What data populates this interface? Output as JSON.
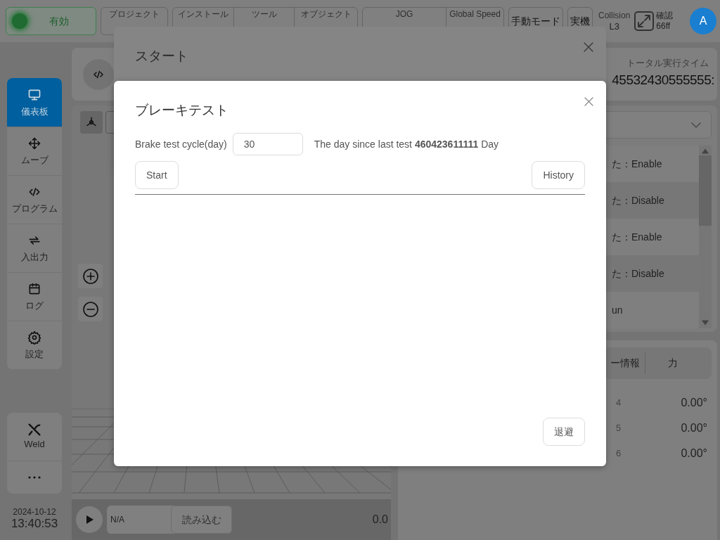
{
  "top_bar": {
    "status_button": {
      "label": "有効",
      "on": true
    },
    "groups": [
      {
        "items": [
          {
            "label": "プロジェクト"
          }
        ]
      },
      {
        "items": [
          {
            "label": "インストール"
          },
          {
            "label": "ツール"
          },
          {
            "label": "オブジェクト"
          }
        ]
      },
      {
        "items": [
          {
            "label": "JOG"
          },
          {
            "label": "Global Speed"
          }
        ]
      }
    ],
    "mode_buttons": [
      "手動モード",
      "実機"
    ],
    "collision": {
      "label": "Collision",
      "value": "L3"
    },
    "confirm": {
      "label": "確認",
      "value": "66ff"
    },
    "avatar": "A"
  },
  "sidebar": {
    "items": [
      {
        "label": "儀表板",
        "selected": true
      },
      {
        "label": "ムーブ",
        "selected": false
      },
      {
        "label": "プログラム",
        "selected": false
      },
      {
        "label": "入出力",
        "selected": false
      },
      {
        "label": "ログ",
        "selected": false
      },
      {
        "label": "設定",
        "selected": false
      }
    ],
    "plugin": {
      "label": "Weld"
    },
    "date": "2024-10-12",
    "time": "13:40:53"
  },
  "viewer": {
    "file_field": "N/A",
    "load_button": "読み込む",
    "reading": "0.0"
  },
  "right_panel": {
    "runtime": {
      "label": "トータル実行タイム",
      "value": "45532430555555:"
    },
    "log_rows": [
      {
        "text": "た：Enable"
      },
      {
        "text": "た：Disable"
      },
      {
        "text": "た：Enable"
      },
      {
        "text": "た：Disable"
      },
      {
        "text": "un"
      }
    ],
    "tabs": [
      {
        "label": "ー情報",
        "selected": false
      },
      {
        "label": "力",
        "selected": false
      }
    ],
    "joints": [
      {
        "label": "4",
        "value": "0.00°"
      },
      {
        "label": "5",
        "value": "0.00°"
      },
      {
        "label": "6",
        "value": "0.00°"
      }
    ]
  },
  "start_dialog": {
    "title": "スタート"
  },
  "brake_dialog": {
    "title": "ブレーキテスト",
    "cycle_label": "Brake test cycle(day)",
    "cycle_value": "30",
    "since_text": "The day since last test **460423611111** Day",
    "start_button": "Start",
    "history_button": "History",
    "evade_button": "退避"
  }
}
